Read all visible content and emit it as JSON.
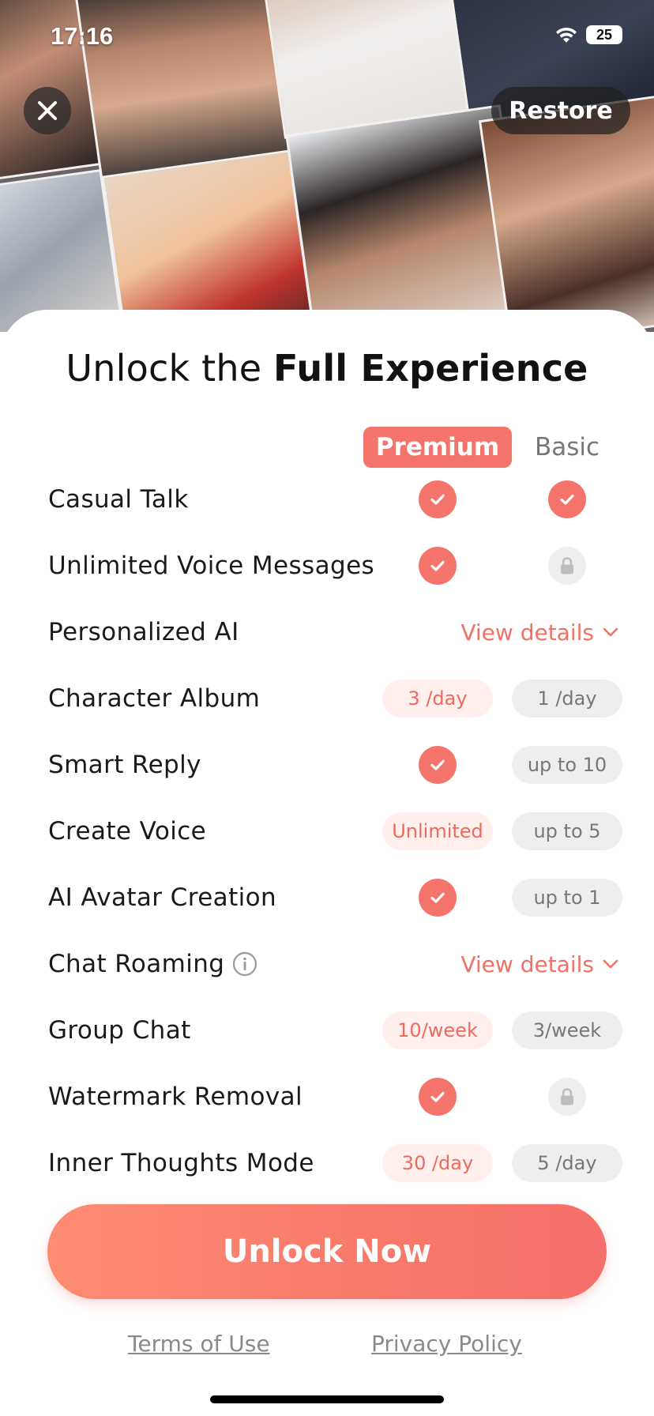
{
  "status_bar": {
    "time": "17:16",
    "battery": "25"
  },
  "header": {
    "restore_label": "Restore",
    "close_icon": "close-icon"
  },
  "title": {
    "prefix": "Unlock the ",
    "emphasis": "Full Experience"
  },
  "columns": {
    "premium": "Premium",
    "basic": "Basic"
  },
  "features": [
    {
      "name": "Casual Talk",
      "premium": "check",
      "basic": "check"
    },
    {
      "name": "Unlimited Voice Messages",
      "premium": "check",
      "basic": "lock"
    },
    {
      "name": "Personalized AI",
      "details": "View details"
    },
    {
      "name": "Character Album",
      "premium_text": "3 /day",
      "basic_text": "1 /day"
    },
    {
      "name": "Smart Reply",
      "premium": "check",
      "basic_text": "up to 10"
    },
    {
      "name": "Create Voice",
      "premium_text": "Unlimited",
      "basic_text": "up to 5"
    },
    {
      "name": "AI Avatar Creation",
      "premium": "check",
      "basic_text": "up to 1"
    },
    {
      "name": "Chat Roaming",
      "info_icon": true,
      "details": "View details"
    },
    {
      "name": "Group Chat",
      "premium_text": "10/week",
      "basic_text": "3/week"
    },
    {
      "name": "Watermark Removal",
      "premium": "check",
      "basic": "lock"
    },
    {
      "name": "Inner Thoughts Mode",
      "premium_text": "30 /day",
      "basic_text": "5 /day"
    }
  ],
  "cta": {
    "label": "Unlock Now"
  },
  "footer": {
    "terms": "Terms of Use",
    "privacy": "Privacy Policy"
  },
  "colors": {
    "accent": "#F4736A",
    "cta_start": "#FD8C73",
    "cta_end": "#F66F6B"
  }
}
